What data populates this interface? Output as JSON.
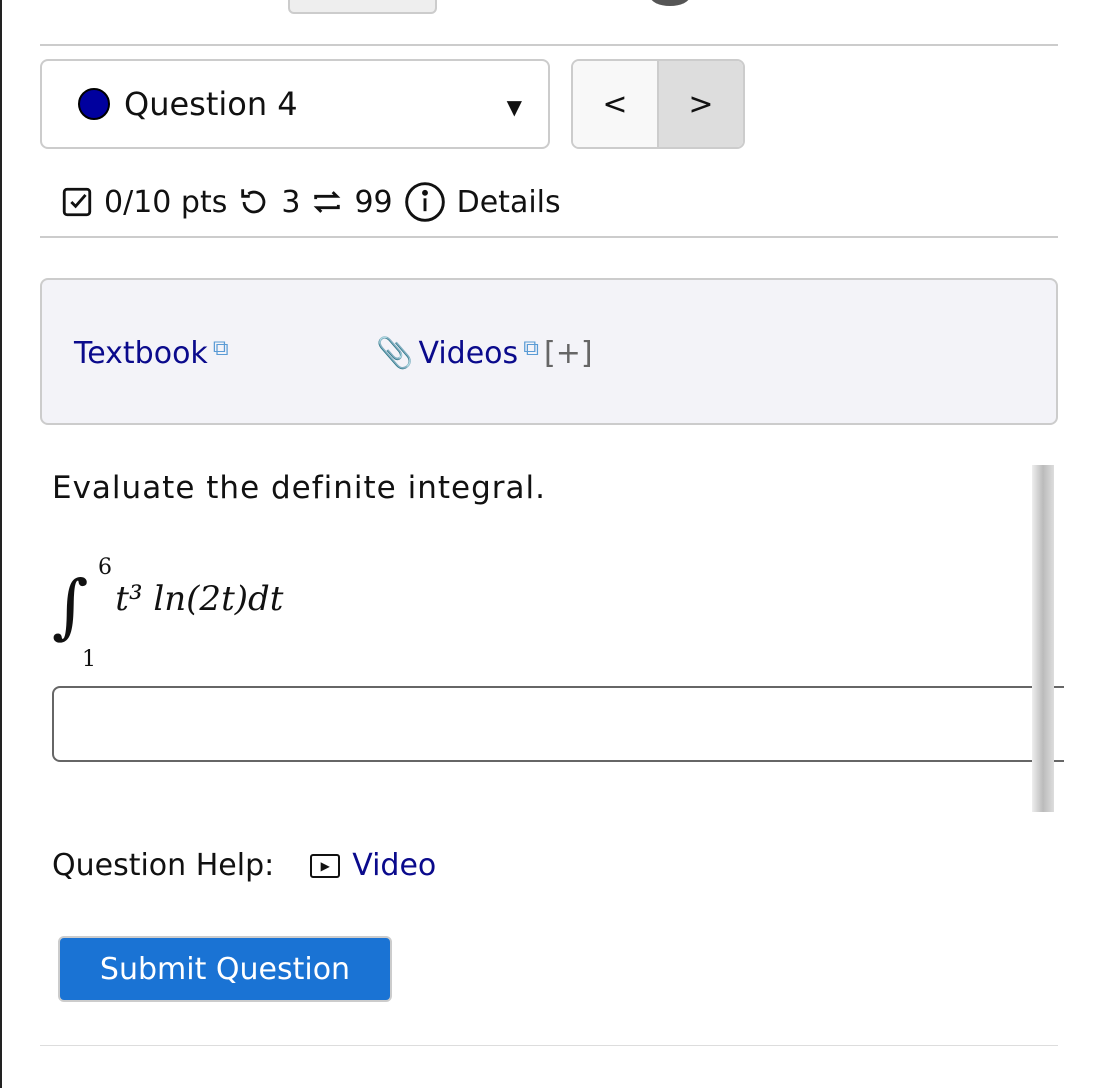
{
  "question_selector": {
    "label": "Question 4",
    "status_color": "#00009e"
  },
  "nav": {
    "prev": "<",
    "next": ">"
  },
  "meta": {
    "score": "0/10 pts",
    "retries": "3",
    "attempts": "99",
    "details": "Details"
  },
  "resources": {
    "textbook": "Textbook",
    "videos": "Videos",
    "expand": "[+]"
  },
  "question": {
    "prompt": "Evaluate the definite integral.",
    "integral": {
      "lower": "1",
      "upper": "6",
      "integrand": "t³ ln(2t)dt"
    },
    "answer_value": ""
  },
  "help": {
    "label": "Question Help:",
    "video": "Video"
  },
  "submit": {
    "label": "Submit Question"
  },
  "colors": {
    "link": "#0a0a8c",
    "submit": "#1a73d4"
  }
}
